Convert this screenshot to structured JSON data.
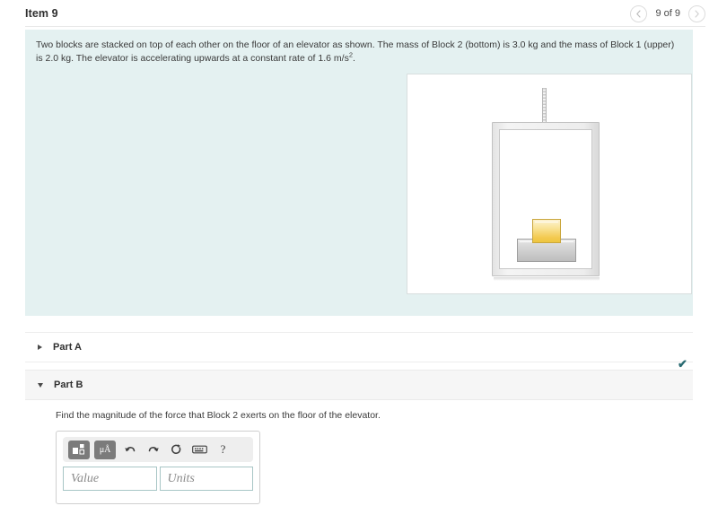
{
  "header": {
    "item_title": "Item 9",
    "nav": {
      "prev_icon": "chevron-left-icon",
      "next_icon": "chevron-right-icon",
      "counter": "9 of 9"
    }
  },
  "problem": {
    "text_before_sup": "Two blocks are stacked on top of each other on the floor of an elevator as shown.  The mass of Block 2 (bottom) is 3.0 kg and the mass of Block 1 (upper) is 2.0 kg. The elevator is accelerating upwards at a constant rate of 1.6 m/s",
    "exponent": "2",
    "text_after_sup": ".",
    "figure": {
      "alt": "elevator-diagram",
      "cable_label": "elevator-cable",
      "car_label": "elevator-car",
      "block_bottom_label": "block-2-bottom",
      "block_top_label": "block-1-upper",
      "block_top_color": "#f3c94f",
      "block_bottom_color": "#c7c7c7"
    },
    "background_color": "#e4f1f1"
  },
  "parts": {
    "part_a": {
      "label": "Part A",
      "expanded": false,
      "toggle_icon": "triangle-right-icon",
      "status_icon": "check-icon",
      "status_color": "#2a6b72"
    },
    "part_b": {
      "label": "Part B",
      "expanded": true,
      "toggle_icon": "triangle-down-icon",
      "question": "Find the magnitude of the force that Block 2 exerts on the floor of the elevator.",
      "answer": {
        "toolbar": [
          {
            "name": "template-icon",
            "label": ""
          },
          {
            "name": "units-icon",
            "label": "μÅ"
          },
          {
            "name": "undo-icon",
            "label": ""
          },
          {
            "name": "redo-icon",
            "label": ""
          },
          {
            "name": "reset-icon",
            "label": ""
          },
          {
            "name": "keyboard-icon",
            "label": ""
          },
          {
            "name": "help-icon",
            "label": "?"
          }
        ],
        "value_field": {
          "placeholder": "Value",
          "value": ""
        },
        "units_field": {
          "placeholder": "Units",
          "value": ""
        }
      }
    }
  }
}
